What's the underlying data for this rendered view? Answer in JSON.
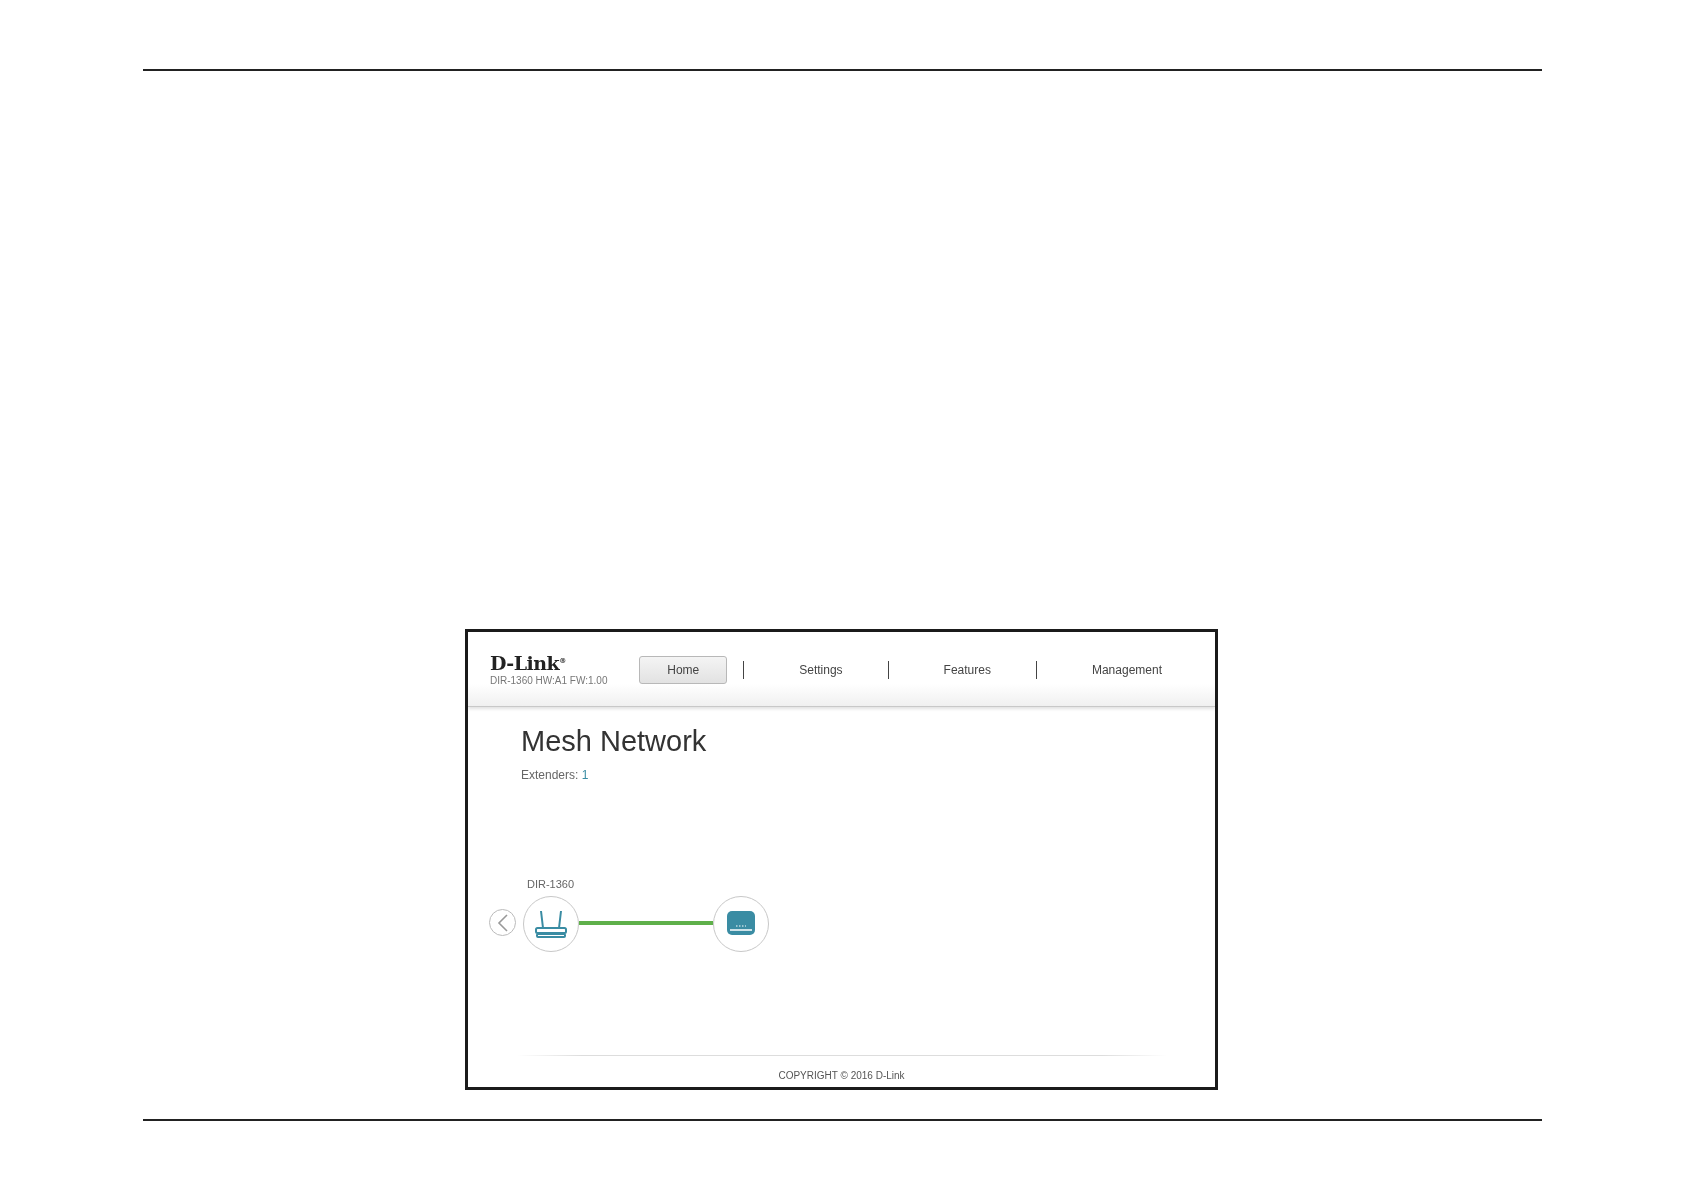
{
  "header": {
    "logo": "D-Link$^{®}$",
    "model_info": "DIR-1360 HW:A1 FW:1.00"
  },
  "nav_tabs": [
    {
      "label": "Home",
      "selected": true
    },
    {
      "label": "Settings",
      "selected": false
    },
    {
      "label": "Features",
      "selected": false
    },
    {
      "label": "Management",
      "selected": false
    }
  ],
  "page_title": "Mesh Network",
  "extenders": {
    "label": "Extenders:",
    "count": "1"
  },
  "topology": {
    "router_label": "DIR-1360",
    "link_connected": true
  },
  "footer": {
    "copyright": "COPYRIGHT © 2016 D-Link"
  }
}
